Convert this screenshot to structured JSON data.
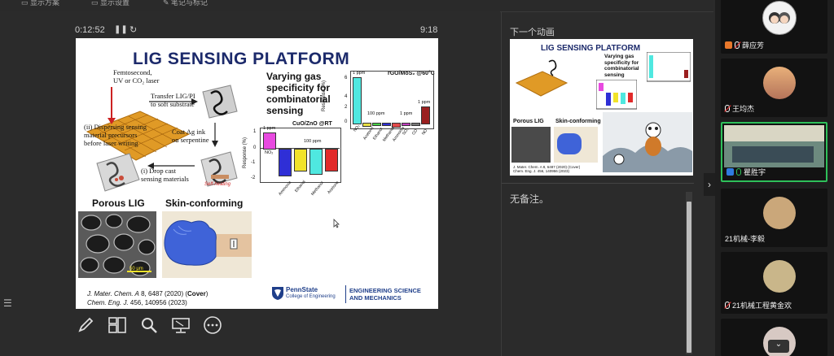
{
  "topbar": {
    "items": [
      "显示方案",
      "显示设置",
      "笔记与标记"
    ]
  },
  "presenter": {
    "elapsed": "0:12:52",
    "pause_icon": "pause-icon",
    "reload_icon": "reset-icon",
    "duration": "9:18",
    "tool_icons": [
      "pen-icon",
      "layout-icon",
      "search-icon",
      "screen-icon",
      "more-icon"
    ]
  },
  "slide": {
    "title": "LIG SENSING PLATFORM",
    "left_labels": {
      "laser": "Femtosecond,\nUV or CO₂ laser",
      "transfer": "Transfer LIG/PI\nto soft substrate",
      "dispersing": "(ii) Dispersing sensing\nmaterial precursors\nbefore laser writing",
      "coat": "Coat Ag ink\non serpentine",
      "dropcast": "(i) Drop cast\nsensing materials",
      "self_heating": "Self-heating"
    },
    "varying_title": "Varying gas\nspecificity for\ncombinatorial\nsensing",
    "chart1": {
      "title": "CuO/ZnO @RT",
      "ylabel": "Response (%)",
      "yticks": [
        "1",
        "0",
        "-1",
        "-2"
      ],
      "annot_1ppm": "1 ppm",
      "annot_100ppm": "100 ppm",
      "categories": [
        "NO₂",
        "Ammonia",
        "Ethanol",
        "Methanol",
        "Acetone"
      ]
    },
    "chart2": {
      "title": "rGO/MoS₂ @60°C",
      "ylabel": "Response (%)",
      "yticks": [
        "6",
        "4",
        "2",
        "0"
      ],
      "annot_1ppm": "1 ppm",
      "annot_100ppm": "100 ppm",
      "annot_1ppm_b": "1 ppm",
      "annot_1ppm_c": "1 ppm",
      "categories": [
        "NO₂",
        "Acetone",
        "Ethanol",
        "Methanol",
        "Ammonia",
        "SO₂",
        "CO",
        "NO"
      ]
    },
    "porous_label": "Porous LIG",
    "skin_label": "Skin-conforming",
    "scale_label": "50 μm",
    "ref1_prefix": "J. Mater. Chem. A",
    "ref1_rest": " 8, 6487 (2020) (",
    "ref1_cover": "Cover",
    "ref1_end": ")",
    "ref2_prefix": "Chem. Eng. J.",
    "ref2_rest": " 456, 140956 (2023)",
    "psu_name": "PennState",
    "psu_college": "College of Engineering",
    "dept": "ENGINEERING SCIENCE\nAND MECHANICS"
  },
  "next": {
    "label": "下一个动画",
    "thumb_title": "LIG SENSING PLATFORM",
    "thumb_varying": "Varying gas\nspecificity for\ncombinatorial\nsensing",
    "thumb_porous": "Porous LIG",
    "thumb_skin": "Skin-conforming",
    "thumb_ref": "J. Mater. Chem. A 8, 6487 (2020) (Cover)\nChem. Eng. J. 456, 140956 (2023)"
  },
  "notes": {
    "text": "无备注。"
  },
  "participants": [
    {
      "name": "薛应芳",
      "badge_color": "#e8782b"
    },
    {
      "name": "王均杰",
      "badge_color": ""
    },
    {
      "name": "瞿胜宇",
      "badge_color": "#2f7be0"
    },
    {
      "name": "21机械-李毅",
      "badge_color": ""
    },
    {
      "name": "21机械工程黄金欢",
      "badge_color": ""
    }
  ],
  "colors": {
    "bg": "#2b2b2b",
    "panel": "#1e1e1e",
    "title_blue": "#1c2a6b",
    "psu_blue": "#1f3f8a"
  }
}
